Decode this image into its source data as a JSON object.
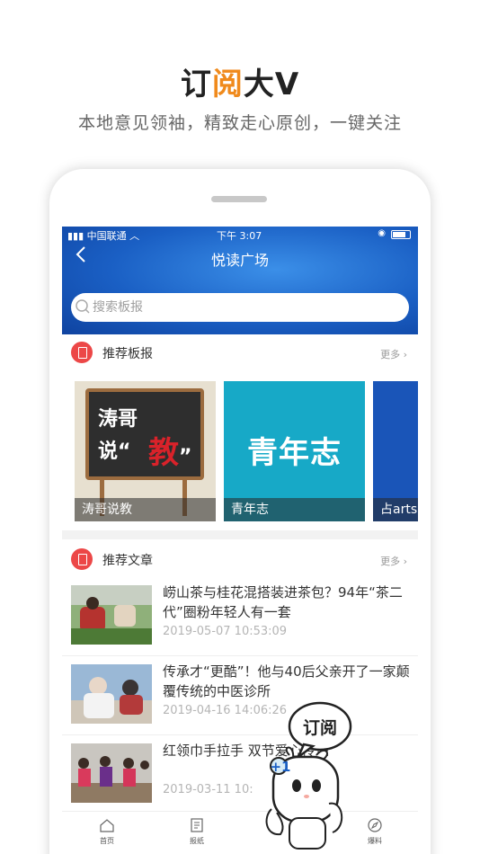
{
  "promo": {
    "title_part1": "订",
    "title_accent": "阅",
    "title_part2": "大V",
    "subtitle": "本地意见领袖，精致走心原创，一键关注"
  },
  "status_bar": {
    "carrier": "中国联通",
    "time": "下午 3:07"
  },
  "nav": {
    "title": "悦读广场"
  },
  "search": {
    "placeholder": "搜索板报"
  },
  "boards_section": {
    "label": "推荐板报",
    "more": "更多",
    "cards": [
      {
        "caption": "涛哥说教",
        "art_line1": "涛哥",
        "art_line2": "说“",
        "art_big": "教",
        "art_close": "”"
      },
      {
        "caption": "青年志",
        "art_big": "青年志"
      },
      {
        "caption": "占arts"
      }
    ]
  },
  "articles_section": {
    "label": "推荐文章",
    "more": "更多",
    "items": [
      {
        "title": "崂山茶与桂花混搭装进茶包？94年“茶二代”圈粉年轻人有一套",
        "date": "2019-05-07 10:53:09"
      },
      {
        "title": "传承才“更酷”！他与40后父亲开了一家颠覆传统的中医诊所",
        "date": "2019-04-16 14:06:26"
      },
      {
        "title": "红领巾手拉手 双节爱心传递",
        "date": "2019-03-11 10:"
      }
    ]
  },
  "tabbar": {
    "items": [
      "首页",
      "报纸",
      "",
      "爆料"
    ]
  },
  "mascot": {
    "bubble": "订阅",
    "plus": "+1"
  },
  "colors": {
    "accent": "#f08a1c",
    "header_blue": "#1a5fc4",
    "section_red": "#ec4747"
  }
}
